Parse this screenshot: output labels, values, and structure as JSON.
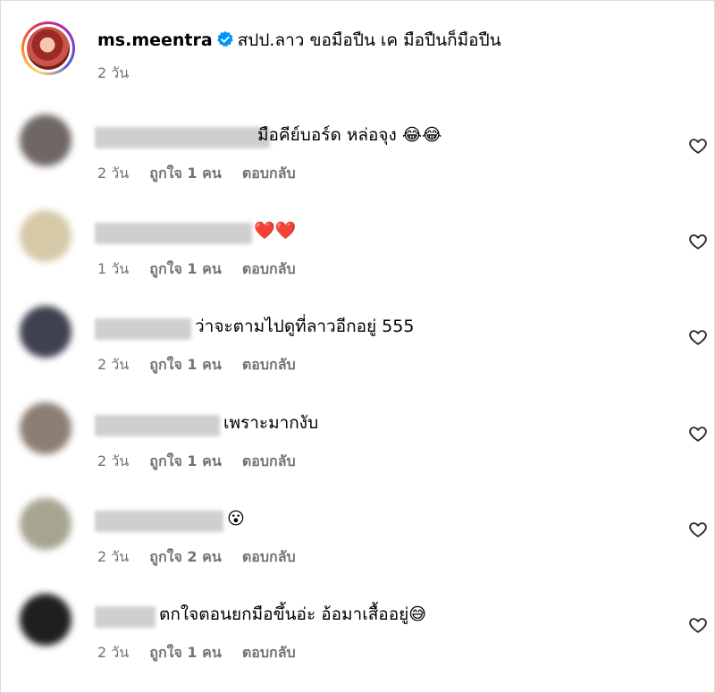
{
  "post": {
    "username": "ms.meentra",
    "caption": "สปป.ลาว ขอมือปืน เค มือปืนก็มือปืน",
    "time": "2 วัน"
  },
  "comments": [
    {
      "text": "มือคีย์บอร์ด หล่อจุง 😂😂",
      "time": "2 วัน",
      "likes": "ถูกใจ 1 คน",
      "reply": "ตอบกลับ"
    },
    {
      "text": "❤️❤️",
      "time": "1 วัน",
      "likes": "ถูกใจ 1 คน",
      "reply": "ตอบกลับ"
    },
    {
      "text": "ว่าจะตามไปดูที่ลาวอีกอยู่ 555",
      "time": "2 วัน",
      "likes": "ถูกใจ 1 คน",
      "reply": "ตอบกลับ"
    },
    {
      "text": "เพราะมากงับ",
      "time": "2 วัน",
      "likes": "ถูกใจ 1 คน",
      "reply": "ตอบกลับ"
    },
    {
      "text": "😮",
      "time": "2 วัน",
      "likes": "ถูกใจ 2 คน",
      "reply": "ตอบกลับ"
    },
    {
      "text": "ตกใจตอนยกมือขึ้นอ่ะ อ้อมาเสื้ออยู่😅",
      "time": "2 วัน",
      "likes": "ถูกใจ 1 คน",
      "reply": "ตอบกลับ"
    }
  ],
  "icons": {
    "verified": "verified-badge-icon",
    "like": "heart-outline-icon"
  },
  "colors": {
    "verified": "#0095f6",
    "secondary_text": "#737373"
  }
}
